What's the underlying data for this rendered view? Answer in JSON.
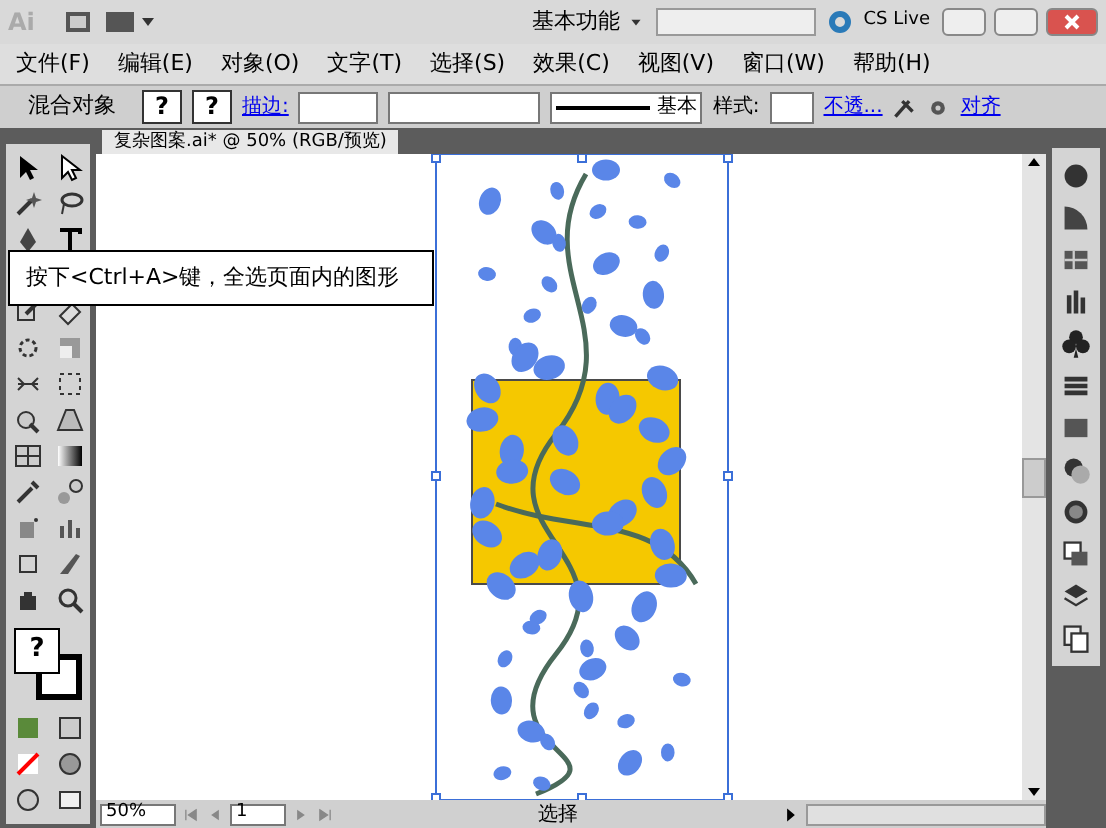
{
  "title_bar": {
    "logo": "Ai",
    "workspace": "基本功能",
    "cs_live": "CS Live"
  },
  "menu": [
    "文件(F)",
    "编辑(E)",
    "对象(O)",
    "文字(T)",
    "选择(S)",
    "效果(C)",
    "视图(V)",
    "窗口(W)",
    "帮助(H)"
  ],
  "control_bar": {
    "selection_label": "混合对象",
    "fill_swatch": "?",
    "stroke_swatch": "?",
    "stroke_label": "描边:",
    "brush": "基本",
    "style_label": "样式:",
    "opacity_link": "不透...",
    "align_link": "对齐"
  },
  "document_tab": {
    "title": "复杂图案.ai* @ 50% (RGB/预览)"
  },
  "toolbox": {
    "fill_stroke": "?"
  },
  "callout": "按下<Ctrl+A>键，全选页面内的图形",
  "status_bar": {
    "zoom": "50%",
    "artboard": "1",
    "tool": "选择"
  }
}
